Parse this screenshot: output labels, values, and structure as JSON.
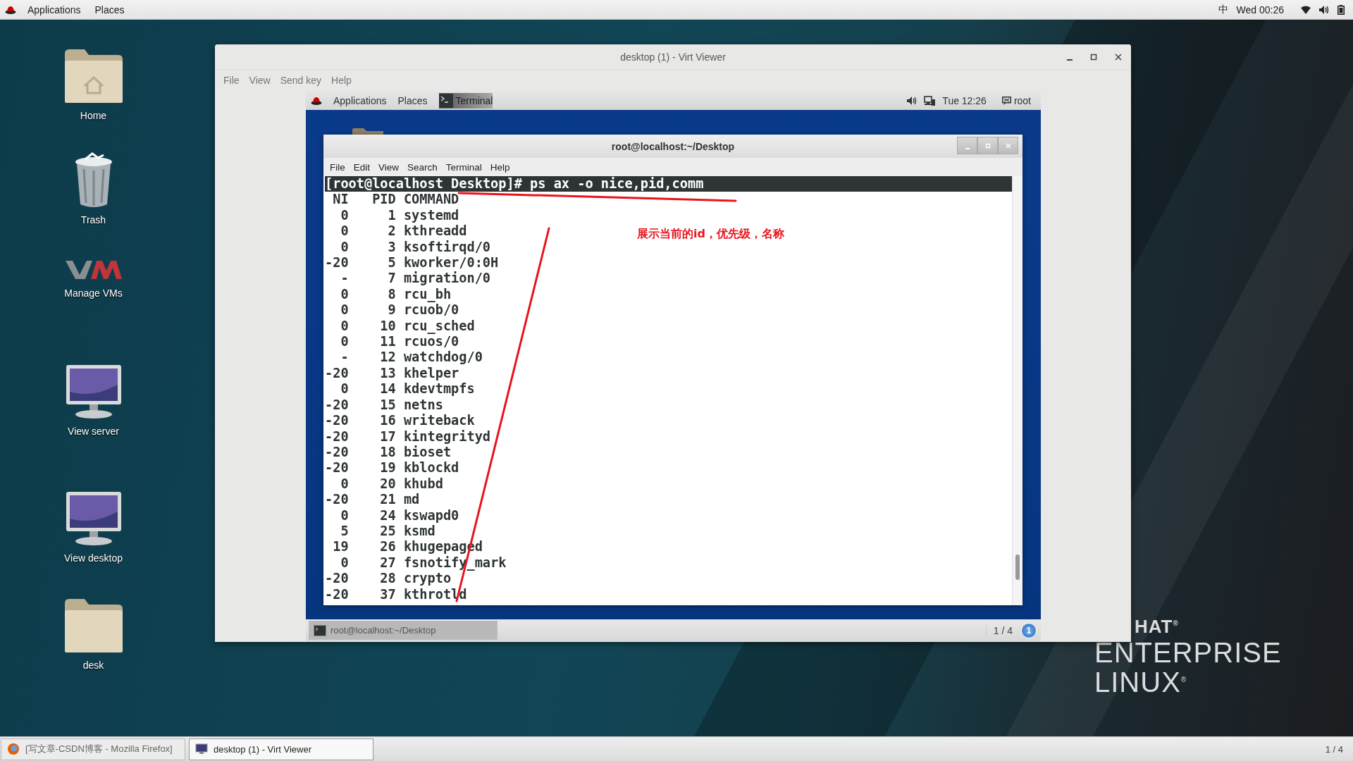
{
  "top_bar": {
    "menus": [
      "Applications",
      "Places"
    ],
    "input_method": "中",
    "clock": "Wed 00:26"
  },
  "desktop_icons": [
    {
      "label": "Home",
      "kind": "home"
    },
    {
      "label": "Trash",
      "kind": "trash"
    },
    {
      "label": "Manage VMs",
      "kind": "vm"
    },
    {
      "label": "View server",
      "kind": "monitor"
    },
    {
      "label": "View desktop",
      "kind": "monitor"
    },
    {
      "label": "desk",
      "kind": "folder"
    }
  ],
  "wallpaper_logo": [
    "HAT$^{®}$",
    "ENTERPRISE",
    "LINUX$^{®}$"
  ],
  "viewer": {
    "title": "desktop (1) - Virt Viewer",
    "menu": [
      "File",
      "View",
      "Send key",
      "Help"
    ],
    "guest": {
      "top_bar": {
        "menus": [
          "Applications",
          "Places"
        ],
        "active_app": "Terminal",
        "clock": "Tue 12:26",
        "user": "root"
      },
      "terminal": {
        "title": "root@localhost:~/Desktop",
        "menu": [
          "File",
          "Edit",
          "View",
          "Search",
          "Terminal",
          "Help"
        ],
        "command": "[root@localhost Desktop]# ps ax -o nice,pid,comm",
        "columns": [
          "NI",
          "PID",
          "COMMAND"
        ],
        "rows": [
          [
            "0",
            "1",
            "systemd"
          ],
          [
            "0",
            "2",
            "kthreadd"
          ],
          [
            "0",
            "3",
            "ksoftirqd/0"
          ],
          [
            "-20",
            "5",
            "kworker/0:0H"
          ],
          [
            "-",
            "7",
            "migration/0"
          ],
          [
            "0",
            "8",
            "rcu_bh"
          ],
          [
            "0",
            "9",
            "rcuob/0"
          ],
          [
            "0",
            "10",
            "rcu_sched"
          ],
          [
            "0",
            "11",
            "rcuos/0"
          ],
          [
            "-",
            "12",
            "watchdog/0"
          ],
          [
            "-20",
            "13",
            "khelper"
          ],
          [
            "0",
            "14",
            "kdevtmpfs"
          ],
          [
            "-20",
            "15",
            "netns"
          ],
          [
            "-20",
            "16",
            "writeback"
          ],
          [
            "-20",
            "17",
            "kintegrityd"
          ],
          [
            "-20",
            "18",
            "bioset"
          ],
          [
            "-20",
            "19",
            "kblockd"
          ],
          [
            "0",
            "20",
            "khubd"
          ],
          [
            "-20",
            "21",
            "md"
          ],
          [
            "0",
            "24",
            "kswapd0"
          ],
          [
            "5",
            "25",
            "ksmd"
          ],
          [
            "19",
            "26",
            "khugepaged"
          ],
          [
            "0",
            "27",
            "fsnotify_mark"
          ],
          [
            "-20",
            "28",
            "crypto"
          ],
          [
            "-20",
            "37",
            "kthrotld"
          ]
        ]
      },
      "annotation": "展示当前的id，优先级，名称",
      "bottom_panel": {
        "tasks": [
          {
            "label": "root@localhost:~/Desktop",
            "selected": true
          }
        ],
        "workspace": "1 / 4",
        "badge": "1"
      }
    }
  },
  "taskbar": {
    "tasks": [
      {
        "label": "[写文章-CSDN博客 - Mozilla Firefox]",
        "kind": "browser",
        "selected": false
      },
      {
        "label": "desktop (1) - Virt Viewer",
        "kind": "viewer",
        "selected": true
      }
    ],
    "workspace": "1 / 4"
  }
}
